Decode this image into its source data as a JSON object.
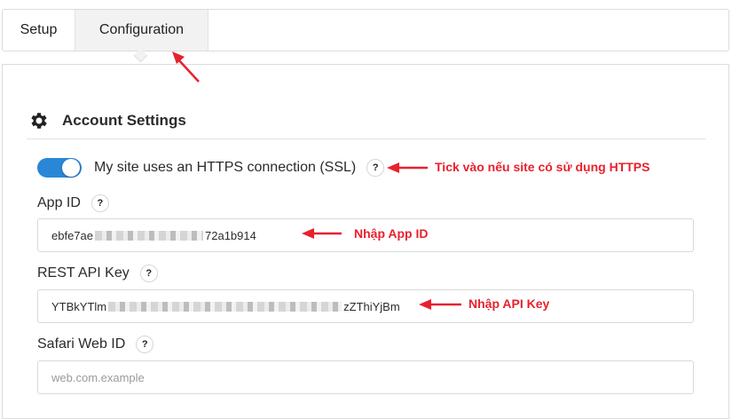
{
  "tabs": [
    {
      "label": "Setup"
    },
    {
      "label": "Configuration"
    }
  ],
  "section": {
    "title": "Account Settings",
    "icon": "gear-icon"
  },
  "ssl": {
    "label": "My site uses an HTTPS connection (SSL)",
    "enabled": true,
    "help": "?"
  },
  "app_id": {
    "label": "App ID",
    "help": "?",
    "value_start": "ebfe7ae",
    "value_end": "72a1b914"
  },
  "rest_api_key": {
    "label": "REST API Key",
    "help": "?",
    "value_start": "YTBkYTlm",
    "value_end": "zZThiYjBm"
  },
  "safari": {
    "label": "Safari Web ID",
    "help": "?",
    "placeholder": "web.com.example"
  },
  "annotations": {
    "ssl_note": "Tick vào nếu site có sử dụng HTTPS",
    "app_id_note": "Nhập App ID",
    "api_key_note": "Nhập API Key"
  },
  "colors": {
    "toggle": "#2a86d6",
    "annotation": "#e8212e"
  }
}
